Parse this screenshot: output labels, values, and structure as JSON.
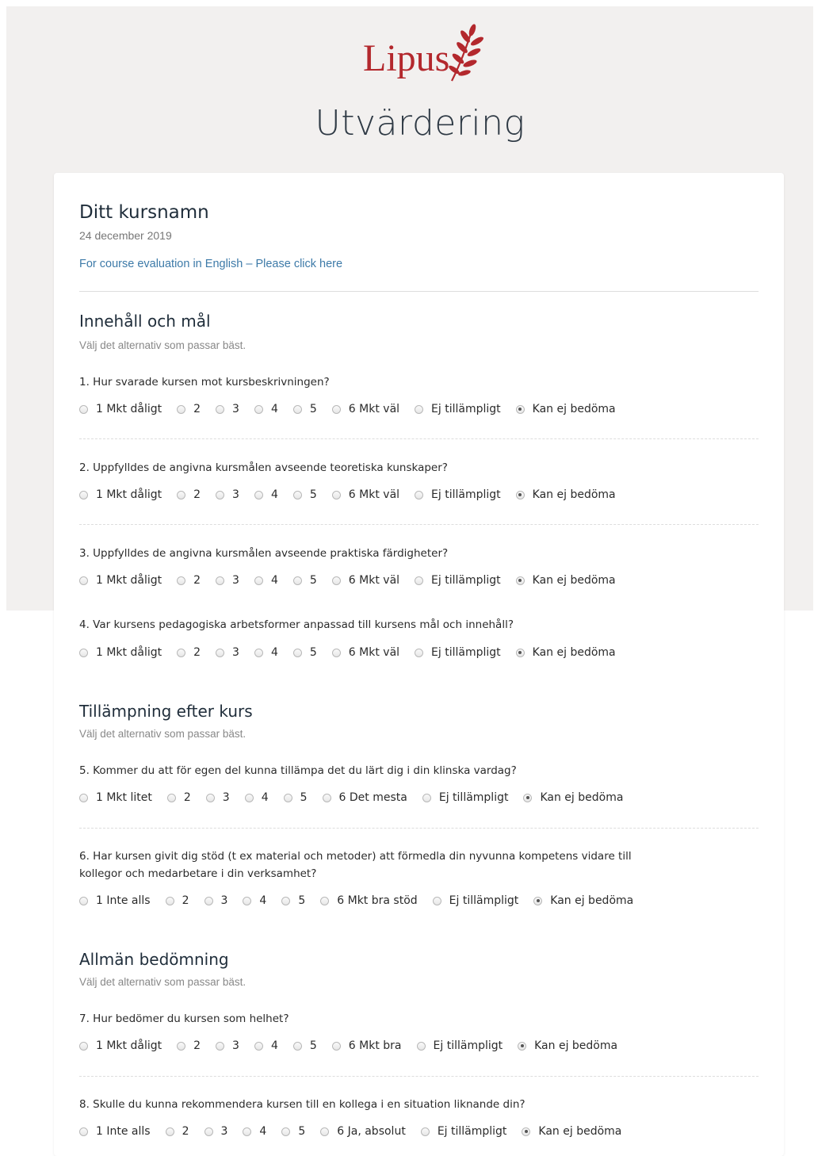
{
  "header": {
    "logo_text": "Lipus",
    "title": "Utvärdering"
  },
  "course": {
    "name": "Ditt kursnamn",
    "date": "24 december 2019",
    "english_link": "For course evaluation in English – Please click here"
  },
  "sections": [
    {
      "title": "Innehåll och mål",
      "hint": "Välj det alternativ som passar bäst.",
      "questions": [
        {
          "text": "1. Hur svarade kursen mot kursbeskrivningen?",
          "options": [
            "1 Mkt dåligt",
            "2",
            "3",
            "4",
            "5",
            "6 Mkt väl",
            "Ej tillämpligt",
            "Kan ej bedöma"
          ],
          "selected": "Kan ej bedöma"
        },
        {
          "text": "2. Uppfylldes de angivna kursmålen avseende teoretiska kunskaper?",
          "options": [
            "1 Mkt dåligt",
            "2",
            "3",
            "4",
            "5",
            "6 Mkt väl",
            "Ej tillämpligt",
            "Kan ej bedöma"
          ],
          "selected": "Kan ej bedöma"
        },
        {
          "text": "3. Uppfylldes de angivna kursmålen avseende praktiska färdigheter?",
          "options": [
            "1 Mkt dåligt",
            "2",
            "3",
            "4",
            "5",
            "6 Mkt väl",
            "Ej tillämpligt",
            "Kan ej bedöma"
          ],
          "selected": "Kan ej bedöma"
        },
        {
          "text": "4. Var kursens pedagogiska arbetsformer anpassad till kursens mål och innehåll?",
          "options": [
            "1 Mkt dåligt",
            "2",
            "3",
            "4",
            "5",
            "6 Mkt väl",
            "Ej tillämpligt",
            "Kan ej bedöma"
          ],
          "selected": "Kan ej bedöma"
        }
      ]
    },
    {
      "title": "Tillämpning efter kurs",
      "hint": "Välj det alternativ som passar bäst.",
      "questions": [
        {
          "text": "5. Kommer du att för egen del kunna tillämpa det du lärt dig i din klinska vardag?",
          "options": [
            "1 Mkt litet",
            "2",
            "3",
            "4",
            "5",
            "6 Det mesta",
            "Ej tillämpligt",
            "Kan ej bedöma"
          ],
          "selected": "Kan ej bedöma"
        },
        {
          "text": "6. Har kursen givit dig stöd (t ex material och metoder) att förmedla din nyvunna kompetens vidare till kollegor och medarbetare i din verksamhet?",
          "options": [
            "1 Inte alls",
            "2",
            "3",
            "4",
            "5",
            "6 Mkt bra stöd",
            "Ej tillämpligt",
            "Kan ej bedöma"
          ],
          "selected": "Kan ej bedöma"
        }
      ]
    },
    {
      "title": "Allmän bedömning",
      "hint": "Välj det alternativ som passar bäst.",
      "questions": [
        {
          "text": "7. Hur bedömer du kursen som helhet?",
          "options": [
            "1 Mkt dåligt",
            "2",
            "3",
            "4",
            "5",
            "6 Mkt bra",
            "Ej tillämpligt",
            "Kan ej bedöma"
          ],
          "selected": "Kan ej bedöma"
        },
        {
          "text": "8. Skulle du kunna rekommendera kursen till en kollega i en situation liknande din?",
          "options": [
            "1 Inte alls",
            "2",
            "3",
            "4",
            "5",
            "6 Ja, absolut",
            "Ej tillämpligt",
            "Kan ej bedöma"
          ],
          "selected": "Kan ej bedöma"
        }
      ]
    }
  ],
  "colors": {
    "brand": "#b3282d",
    "link": "#3d7aa8",
    "page_bg": "#f2f0ef",
    "heading": "#1f2d3a"
  }
}
